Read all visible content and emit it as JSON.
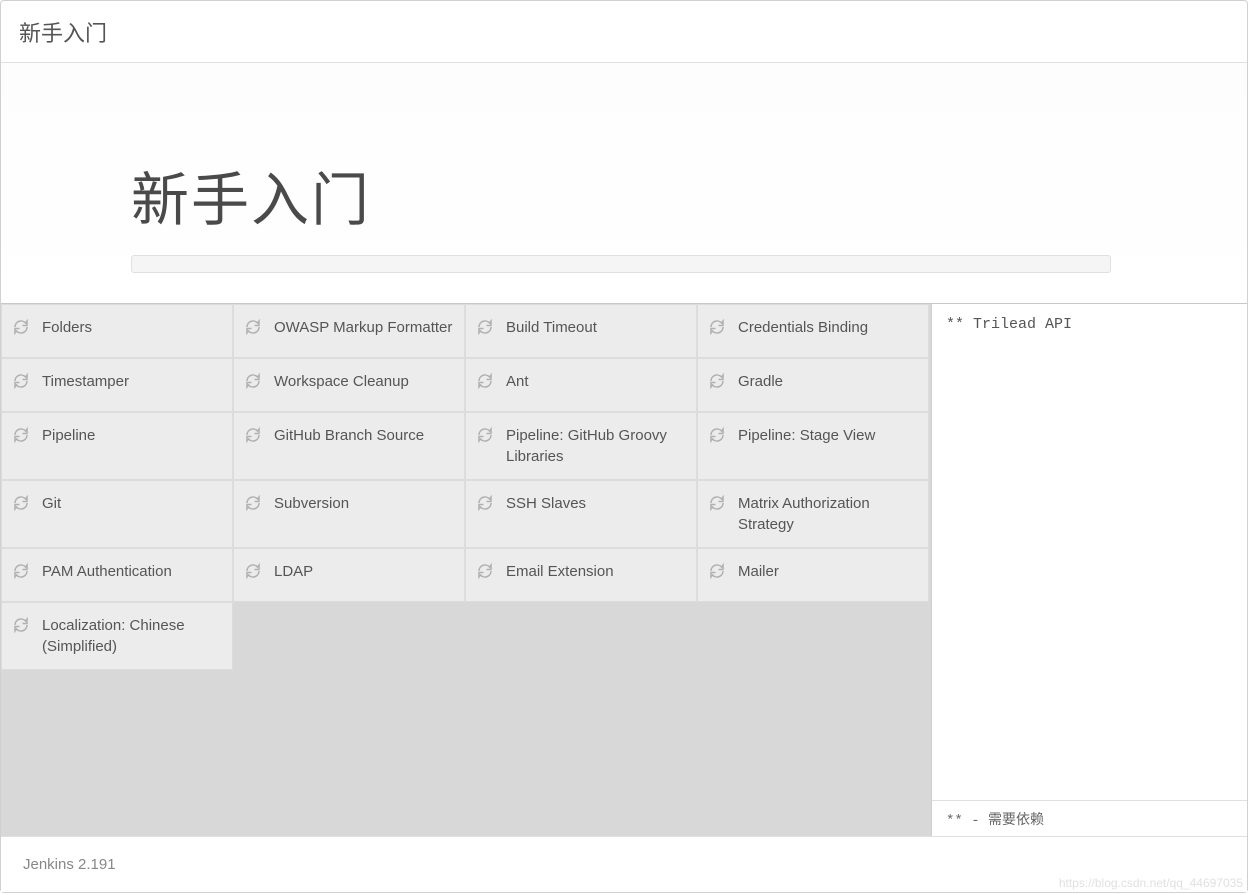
{
  "window_title": "新手入门",
  "hero": {
    "title": "新手入门"
  },
  "plugins": [
    {
      "name": "Folders"
    },
    {
      "name": "OWASP Markup Formatter"
    },
    {
      "name": "Build Timeout"
    },
    {
      "name": "Credentials Binding"
    },
    {
      "name": "Timestamper"
    },
    {
      "name": "Workspace Cleanup"
    },
    {
      "name": "Ant"
    },
    {
      "name": "Gradle"
    },
    {
      "name": "Pipeline"
    },
    {
      "name": "GitHub Branch Source"
    },
    {
      "name": "Pipeline: GitHub Groovy Libraries"
    },
    {
      "name": "Pipeline: Stage View"
    },
    {
      "name": "Git"
    },
    {
      "name": "Subversion"
    },
    {
      "name": "SSH Slaves"
    },
    {
      "name": "Matrix Authorization Strategy"
    },
    {
      "name": "PAM Authentication"
    },
    {
      "name": "LDAP"
    },
    {
      "name": "Email Extension"
    },
    {
      "name": "Mailer"
    },
    {
      "name": "Localization: Chinese (Simplified)"
    }
  ],
  "side": {
    "log_line": "** Trilead API",
    "footer_note": "** - 需要依赖"
  },
  "footer": {
    "version": "Jenkins 2.191"
  },
  "watermark": "https://blog.csdn.net/qq_44697035"
}
